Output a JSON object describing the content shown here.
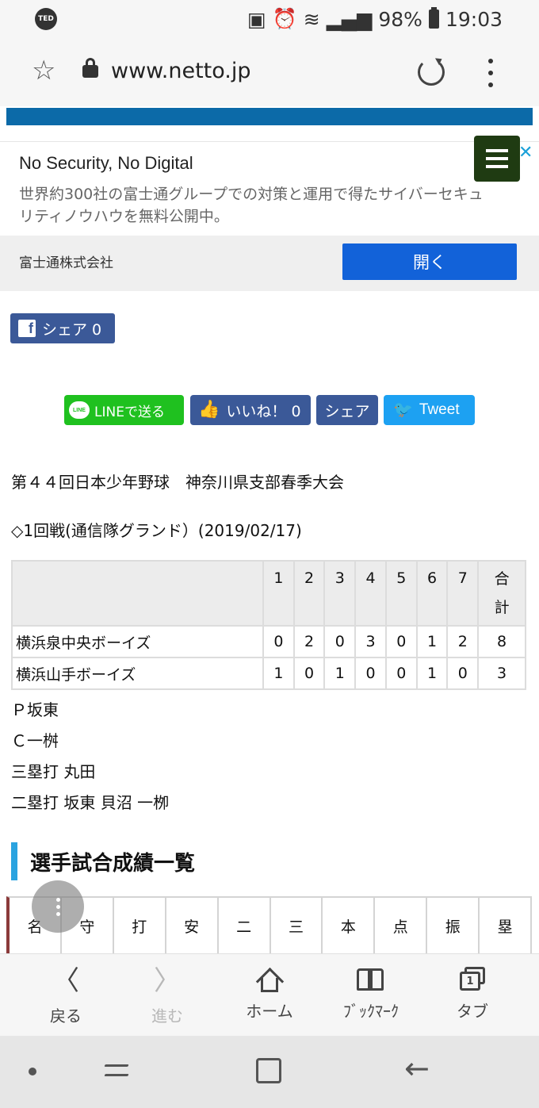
{
  "status_bar": {
    "left_badge": "TED",
    "battery_percent": "98%",
    "time": "19:03",
    "icons": [
      "nfc-icon",
      "alarm-icon",
      "volte-icon",
      "wifi-icon",
      "signal-icon",
      "battery-icon"
    ]
  },
  "browser": {
    "url": "www.netto.jp",
    "icons": [
      "star-icon",
      "lock-icon",
      "reload-icon",
      "menu-icon"
    ]
  },
  "ad": {
    "title": "No Security, No Digital",
    "description": "世界約300社の富士通グループでの対策と運用で得たサイバーセキュリティノウハウを無料公開中。",
    "company": "富士通株式会社",
    "open_label": "開く",
    "close_glyph": "✕"
  },
  "share": {
    "fb_share_label": "シェア 0",
    "line_label": "LINEで送る",
    "line_logo": "LINE",
    "like_label": "いいね！ 0",
    "share_label": "シェア",
    "tweet_label": "Tweet"
  },
  "article": {
    "headline": "第４４回日本少年野球　神奈川県支部春季大会",
    "game_info": "◇1回戦(通信隊グランド）(2019/02/17)",
    "score_table": {
      "innings": [
        "1",
        "2",
        "3",
        "4",
        "5",
        "6",
        "7"
      ],
      "total_label_line1": "合",
      "total_label_line2": "計",
      "rows": [
        {
          "team": "横浜泉中央ボーイズ",
          "scores": [
            "0",
            "2",
            "0",
            "3",
            "0",
            "1",
            "2"
          ],
          "total": "8"
        },
        {
          "team": "横浜山手ボーイズ",
          "scores": [
            "1",
            "0",
            "1",
            "0",
            "0",
            "1",
            "0"
          ],
          "total": "3"
        }
      ]
    },
    "notes": [
      "Ｐ坂東",
      "Ｃ一桝",
      "三塁打 丸田",
      "二塁打 坂東 貝沼 一栁"
    ],
    "section_title": "選手試合成績一覧",
    "stats_headers": [
      "名",
      "守",
      "打",
      "安",
      "二",
      "三",
      "本",
      "点",
      "振",
      "塁"
    ]
  },
  "bottom_nav": {
    "back": "戻る",
    "forward": "進む",
    "home": "ホーム",
    "bookmarks": "ﾌﾞｯｸﾏｰｸ",
    "tabs": "タブ",
    "tab_count": "1"
  }
}
